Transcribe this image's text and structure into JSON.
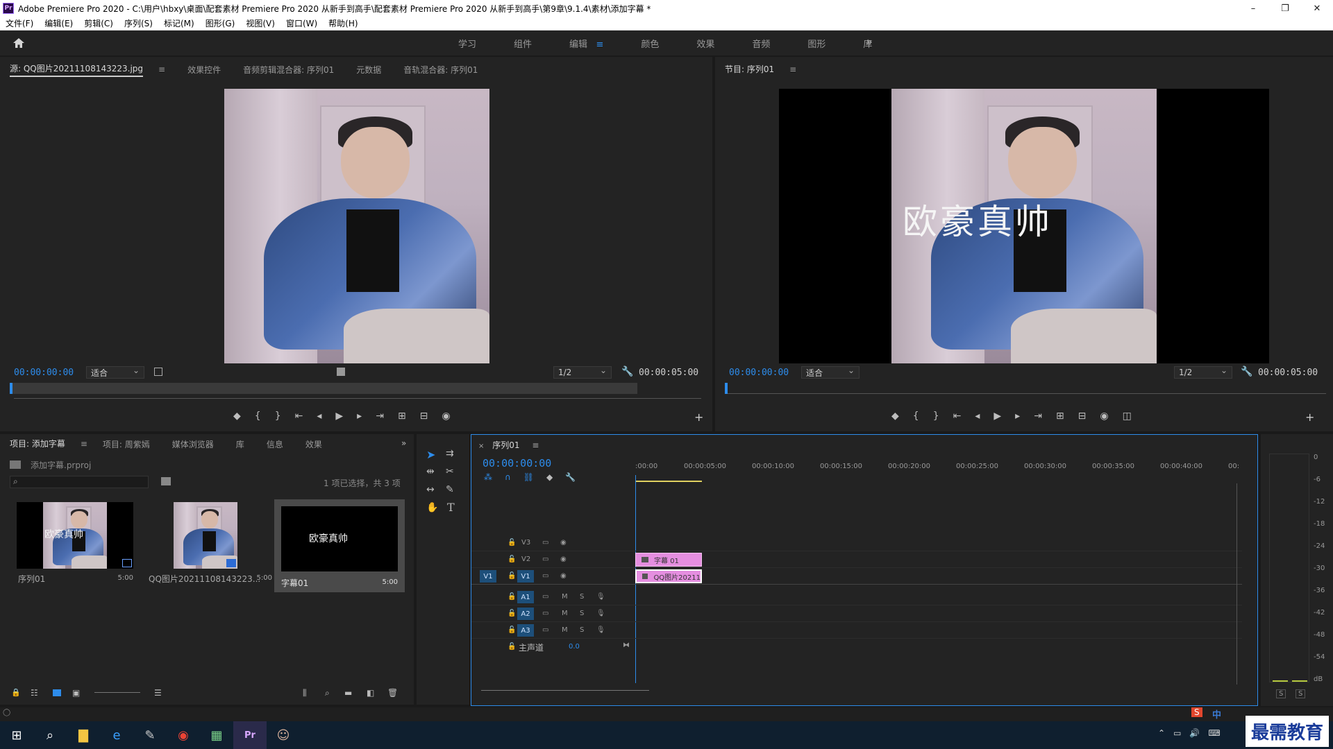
{
  "window": {
    "title": "Adobe Premiere Pro 2020 - C:\\用户\\hbxy\\桌面\\配套素材 Premiere Pro 2020 从新手到高手\\配套素材 Premiere Pro 2020 从新手到高手\\第9章\\9.1.4\\素材\\添加字幕 *",
    "app_logo": "Pr",
    "min": "–",
    "max": "❐",
    "close": "✕"
  },
  "menu": [
    "文件(F)",
    "编辑(E)",
    "剪辑(C)",
    "序列(S)",
    "标记(M)",
    "图形(G)",
    "视图(V)",
    "窗口(W)",
    "帮助(H)"
  ],
  "workspaces": [
    "学习",
    "组件",
    "编辑",
    "颜色",
    "效果",
    "音频",
    "图形",
    "库"
  ],
  "workspace_active_menu": "≡",
  "workspace_more": "»",
  "source_panel": {
    "tabs": [
      "源: QQ图片20211108143223.jpg",
      "效果控件",
      "音频剪辑混合器: 序列01",
      "元数据",
      "音轨混合器: 序列01"
    ],
    "timecode_in": "00:00:00:00",
    "fit": "适合",
    "resolution": "1/2",
    "timecode_out": "00:00:05:00"
  },
  "program_panel": {
    "tab": "节目: 序列01",
    "timecode_in": "00:00:00:00",
    "fit": "适合",
    "resolution": "1/2",
    "timecode_out": "00:00:05:00",
    "caption": "欧豪真帅"
  },
  "project_panel": {
    "tabs": [
      "项目: 添加字幕",
      "项目: 周紫嫣",
      "媒体浏览器",
      "库",
      "信息",
      "效果"
    ],
    "file": "添加字幕.prproj",
    "selection_info": "1 项已选择，共 3 项",
    "items": [
      {
        "name": "序列01",
        "duration": "5:00",
        "caption": "欧豪真帅"
      },
      {
        "name": "QQ图片20211108143223...",
        "duration": "5:00"
      },
      {
        "name": "字幕01",
        "duration": "5:00",
        "caption": "欧豪真帅"
      }
    ]
  },
  "timeline": {
    "tab": "序列01",
    "timecode": "00:00:00:00",
    "ruler": [
      ":00:00",
      "00:00:05:00",
      "00:00:10:00",
      "00:00:15:00",
      "00:00:20:00",
      "00:00:25:00",
      "00:00:30:00",
      "00:00:35:00",
      "00:00:40:00",
      "00:"
    ],
    "video_tracks": [
      "V3",
      "V2",
      "V1"
    ],
    "audio_tracks": [
      "A1",
      "A2",
      "A3"
    ],
    "master": "主声道",
    "master_value": "0.0",
    "source_patch": "V1",
    "clip_title": "字幕 01",
    "clip_image": "QQ图片20211",
    "m": "M",
    "s": "S"
  },
  "meters": [
    "0",
    "-6",
    "-12",
    "-18",
    "-24",
    "-30",
    "-36",
    "-42",
    "-48",
    "-54",
    "dB"
  ],
  "meter_solo": [
    "S",
    "S"
  ],
  "watermark": "最需教育",
  "ime": "中"
}
